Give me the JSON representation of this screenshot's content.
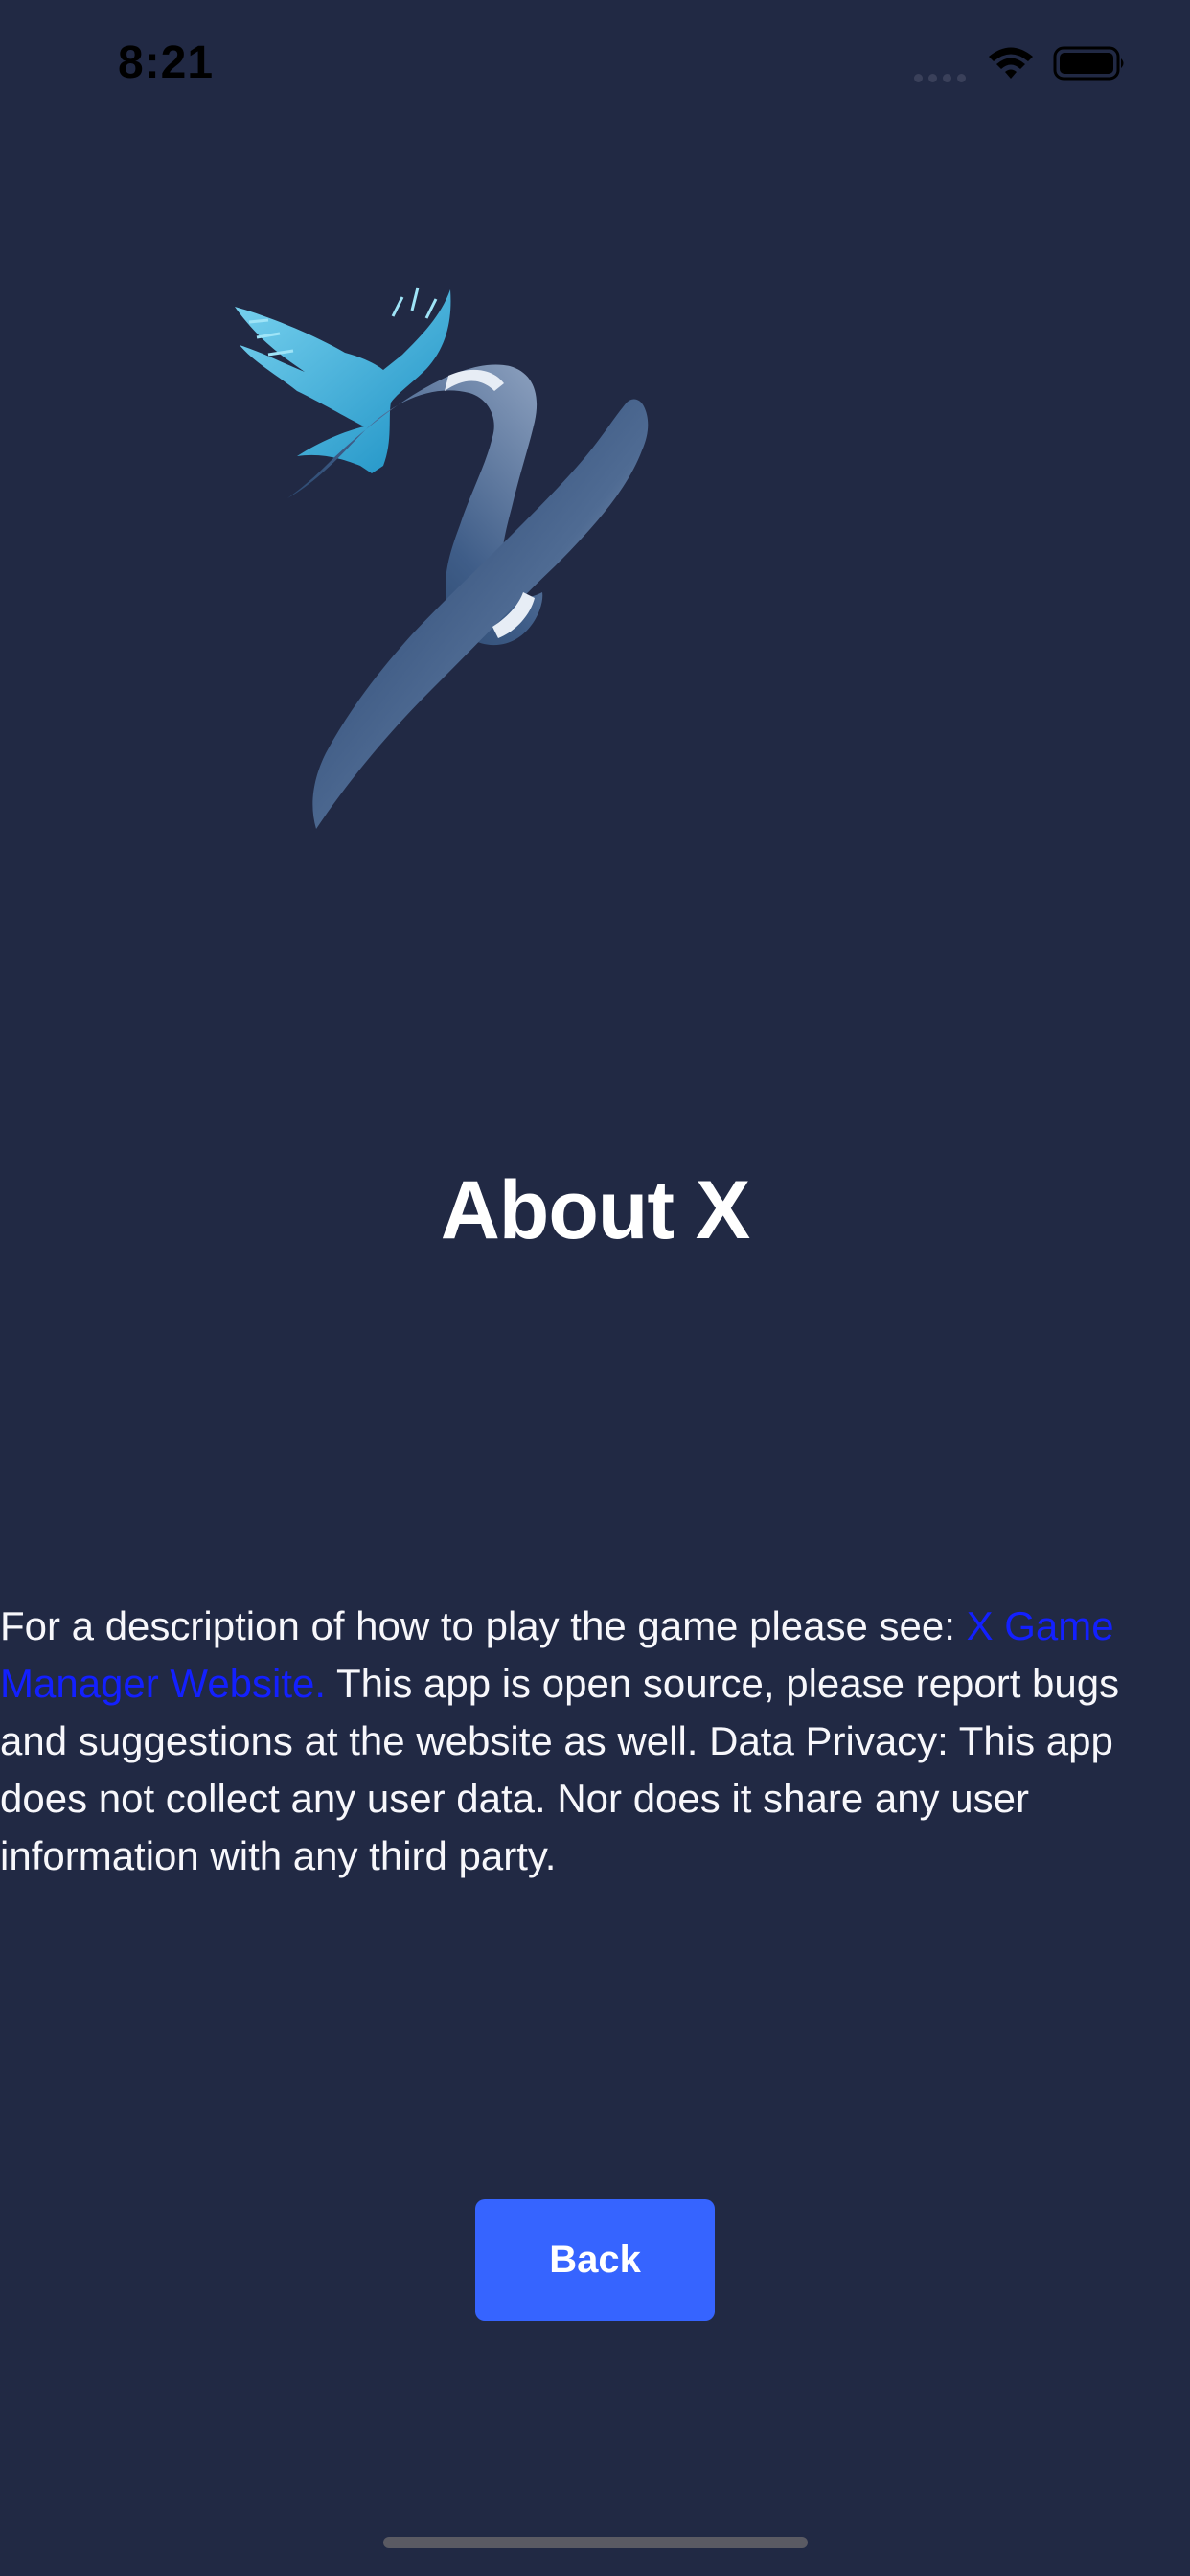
{
  "status_bar": {
    "time": "8:21"
  },
  "logo": {
    "icon": "x-logo-with-eagle"
  },
  "title": "About X",
  "description": {
    "intro": "For a description of how to play the game please see: ",
    "link_text": "X Game Manager Website.",
    "body": " This app is open source, please report bugs and suggestions at the website as well. Data Privacy: This app does not collect any user data. Nor does it share any user information with any third party."
  },
  "back_button": {
    "label": "Back"
  },
  "colors": {
    "background": "#212944",
    "button": "#3664ff",
    "link": "#1320ff"
  }
}
